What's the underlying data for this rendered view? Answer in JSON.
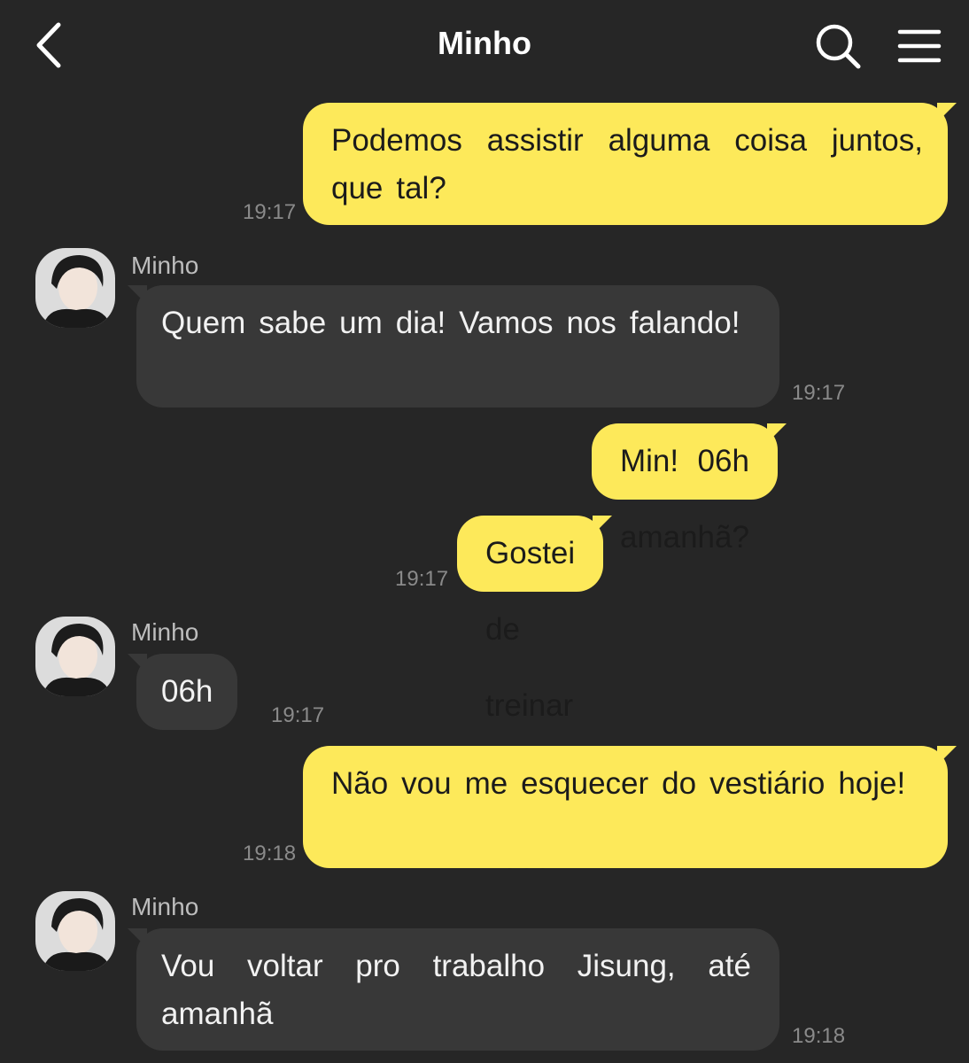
{
  "header": {
    "title": "Minho",
    "back_icon": "chevron-left-icon",
    "search_icon": "search-icon",
    "menu_icon": "hamburger-menu-icon"
  },
  "colors": {
    "background": "#262626",
    "sent_bubble": "#fde95a",
    "received_bubble": "#383838",
    "timestamp": "#8a8a8a"
  },
  "messages": [
    {
      "direction": "sent",
      "text": "Podemos assistir alguma coisa juntos, que tal?",
      "time": "19:17"
    },
    {
      "direction": "received",
      "sender": "Minho",
      "text": "Quem sabe um dia! Vamos nos falando!",
      "time": "19:17"
    },
    {
      "direction": "sent",
      "text": "Min! 06h amanhã?",
      "time": ""
    },
    {
      "direction": "sent",
      "text": "Gostei de treinar com você",
      "time": "19:17"
    },
    {
      "direction": "received",
      "sender": "Minho",
      "text": "06h",
      "time": "19:17"
    },
    {
      "direction": "sent",
      "text": "Não vou me esquecer do vestiário hoje!",
      "time": "19:18"
    },
    {
      "direction": "received",
      "sender": "Minho",
      "text": "Vou voltar pro trabalho Jisung, até amanhã",
      "time": "19:18"
    }
  ]
}
